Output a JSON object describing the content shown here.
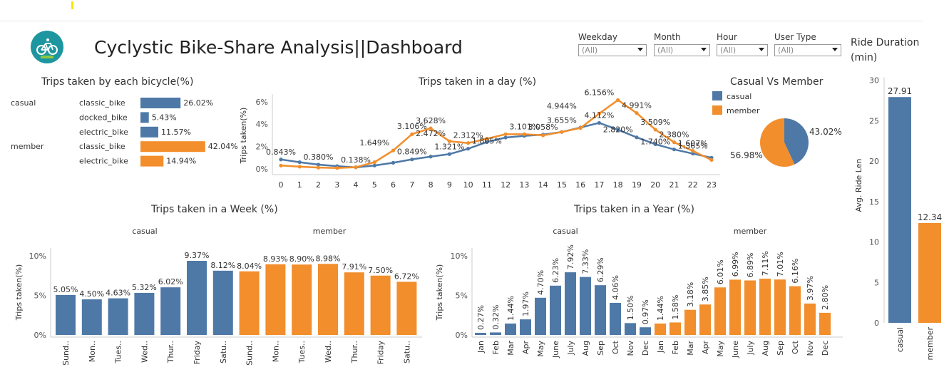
{
  "header": {
    "title": "Cyclystic Bike-Share Analysis||Dashboard",
    "logo_icon": "bicycle-logo-icon"
  },
  "filters": [
    {
      "label": "Weekday",
      "value": "(All)"
    },
    {
      "label": "Month",
      "value": "(All)"
    },
    {
      "label": "Hour",
      "value": "(All)"
    },
    {
      "label": "User Type",
      "value": "(All)"
    }
  ],
  "colors": {
    "casual": "#4e79a7",
    "member": "#f28e2b"
  },
  "chart_data": [
    {
      "id": "bicycle",
      "type": "bar",
      "title": "Trips taken by each bicycle(%)",
      "rows": [
        {
          "group": "casual",
          "category": "classic_bike",
          "value": 26.02,
          "label": "26.02%"
        },
        {
          "group": "",
          "category": "docked_bike",
          "value": 5.43,
          "label": "5.43%"
        },
        {
          "group": "",
          "category": "electric_bike",
          "value": 11.57,
          "label": "11.57%"
        },
        {
          "group": "member",
          "category": "classic_bike",
          "value": 42.04,
          "label": "42.04%"
        },
        {
          "group": "",
          "category": "electric_bike",
          "value": 14.94,
          "label": "14.94%"
        }
      ]
    },
    {
      "id": "day",
      "type": "line",
      "title": "Trips taken in a day (%)",
      "ylabel": "Trips taken(%)",
      "x": [
        0,
        1,
        2,
        3,
        4,
        5,
        6,
        7,
        8,
        9,
        10,
        11,
        12,
        13,
        14,
        15,
        16,
        17,
        18,
        19,
        20,
        21,
        22,
        23
      ],
      "ylim": [
        0,
        7
      ],
      "yticks": [
        "0%",
        "2%",
        "4%",
        "6%"
      ],
      "series": [
        {
          "name": "casual",
          "values": [
            0.843,
            0.6,
            0.38,
            0.25,
            0.138,
            0.3,
            0.55,
            0.849,
            1.1,
            1.321,
            1.805,
            2.4,
            2.8,
            2.95,
            3.058,
            3.3,
            3.7,
            4.112,
            3.5,
            2.82,
            2.2,
            1.74,
            1.365,
            1.0
          ]
        },
        {
          "name": "member",
          "values": [
            0.3,
            0.2,
            0.12,
            0.08,
            0.15,
            0.6,
            1.649,
            3.106,
            3.628,
            2.472,
            2.312,
            2.7,
            3.1,
            3.101,
            3.0,
            3.3,
            3.655,
            4.944,
            6.156,
            4.991,
            3.509,
            2.38,
            1.607,
            0.8
          ]
        }
      ],
      "labels": [
        {
          "x": 0,
          "y": 0.843,
          "text": "0.843%"
        },
        {
          "x": 2,
          "y": 0.38,
          "text": "0.380%"
        },
        {
          "x": 4,
          "y": 0.138,
          "text": "0.138%"
        },
        {
          "x": 5,
          "y": 1.649,
          "text": "1.649%"
        },
        {
          "x": 7,
          "y": 3.106,
          "text": "3.106%"
        },
        {
          "x": 8,
          "y": 3.628,
          "text": "3.628%"
        },
        {
          "x": 8,
          "y": 2.472,
          "text": "2.472%"
        },
        {
          "x": 7,
          "y": 0.849,
          "text": "0.849%"
        },
        {
          "x": 9,
          "y": 1.321,
          "text": "1.321%"
        },
        {
          "x": 10,
          "y": 2.312,
          "text": "2.312%"
        },
        {
          "x": 11,
          "y": 1.805,
          "text": "1.805%"
        },
        {
          "x": 13,
          "y": 3.101,
          "text": "3.101%"
        },
        {
          "x": 14,
          "y": 3.058,
          "text": "3.058%"
        },
        {
          "x": 15,
          "y": 3.655,
          "text": "3.655%"
        },
        {
          "x": 15,
          "y": 4.944,
          "text": "4.944%"
        },
        {
          "x": 17,
          "y": 6.156,
          "text": "6.156%"
        },
        {
          "x": 17,
          "y": 4.112,
          "text": "4.112%"
        },
        {
          "x": 19,
          "y": 4.991,
          "text": "4.991%"
        },
        {
          "x": 18,
          "y": 2.82,
          "text": "2.820%"
        },
        {
          "x": 20,
          "y": 3.509,
          "text": "3.509%"
        },
        {
          "x": 21,
          "y": 2.38,
          "text": "2.380%"
        },
        {
          "x": 20,
          "y": 1.74,
          "text": "1.740%"
        },
        {
          "x": 22,
          "y": 1.607,
          "text": "1.607%"
        },
        {
          "x": 22,
          "y": 1.365,
          "text": "1.365%"
        }
      ]
    },
    {
      "id": "pie",
      "type": "pie",
      "title": "Casual Vs Member",
      "legend": [
        "casual",
        "member"
      ],
      "slices": [
        {
          "name": "casual",
          "value": 43.02,
          "label": "43.02%"
        },
        {
          "name": "member",
          "value": 56.98,
          "label": "56.98%"
        }
      ]
    },
    {
      "id": "week",
      "type": "bar",
      "title": "Trips taken in a Week (%)",
      "ylabel": "Trips taken(%)",
      "ylim": [
        0,
        10
      ],
      "yticks": [
        "0%",
        "5%",
        "10%"
      ],
      "groups": [
        "casual",
        "member"
      ],
      "categories": [
        "Sund..",
        "Mon..",
        "Tues..",
        "Wed..",
        "Thur..",
        "Friday",
        "Satu.."
      ],
      "series": [
        {
          "name": "casual",
          "values": [
            5.05,
            4.5,
            4.63,
            5.32,
            6.02,
            9.37,
            8.12
          ],
          "labels": [
            "5.05%",
            "4.50%",
            "4.63%",
            "5.32%",
            "6.02%",
            "9.37%",
            "8.12%"
          ]
        },
        {
          "name": "member",
          "values": [
            8.04,
            8.93,
            8.9,
            8.98,
            7.91,
            7.5,
            6.72
          ],
          "labels": [
            "8.04%",
            "8.93%",
            "8.90%",
            "8.98%",
            "7.91%",
            "7.50%",
            "6.72%"
          ]
        }
      ]
    },
    {
      "id": "year",
      "type": "bar",
      "title": "Trips taken in a Year (%)",
      "ylabel": "Trips taken(%)",
      "ylim": [
        0,
        10
      ],
      "yticks": [
        "0%",
        "5%",
        "10%"
      ],
      "groups": [
        "casual",
        "member"
      ],
      "categories": [
        "Jan",
        "Feb",
        "Mar",
        "Apr",
        "May",
        "June",
        "July",
        "Aug",
        "Sep",
        "Oct",
        "Nov",
        "Dec"
      ],
      "series": [
        {
          "name": "casual",
          "values": [
            0.27,
            0.32,
            1.44,
            1.97,
            4.7,
            6.23,
            7.92,
            7.33,
            6.29,
            4.06,
            1.5,
            0.97
          ],
          "labels": [
            "0.27%",
            "0.32%",
            "1.44%",
            "1.97%",
            "4.70%",
            "6.23%",
            "7.92%",
            "7.33%",
            "6.29%",
            "4.06%",
            "1.50%",
            "0.97%"
          ]
        },
        {
          "name": "member",
          "values": [
            1.44,
            1.58,
            3.18,
            3.85,
            6.01,
            6.99,
            6.89,
            7.11,
            7.01,
            6.16,
            3.97,
            2.8
          ],
          "labels": [
            "1.44%",
            "1.58%",
            "3.18%",
            "3.85%",
            "6.01%",
            "6.99%",
            "6.89%",
            "7.11%",
            "7.01%",
            "6.16%",
            "3.97%",
            "2.80%"
          ]
        }
      ]
    },
    {
      "id": "ride",
      "type": "bar",
      "title": "Ride Duration (min)",
      "ylabel": "Avg. Ride Len",
      "ylim": [
        0,
        30
      ],
      "yticks": [
        "0",
        "5",
        "10",
        "15",
        "20",
        "25",
        "30"
      ],
      "categories": [
        "casual",
        "member"
      ],
      "values": [
        27.91,
        12.34
      ],
      "labels": [
        "27.91",
        "12.34"
      ]
    }
  ]
}
